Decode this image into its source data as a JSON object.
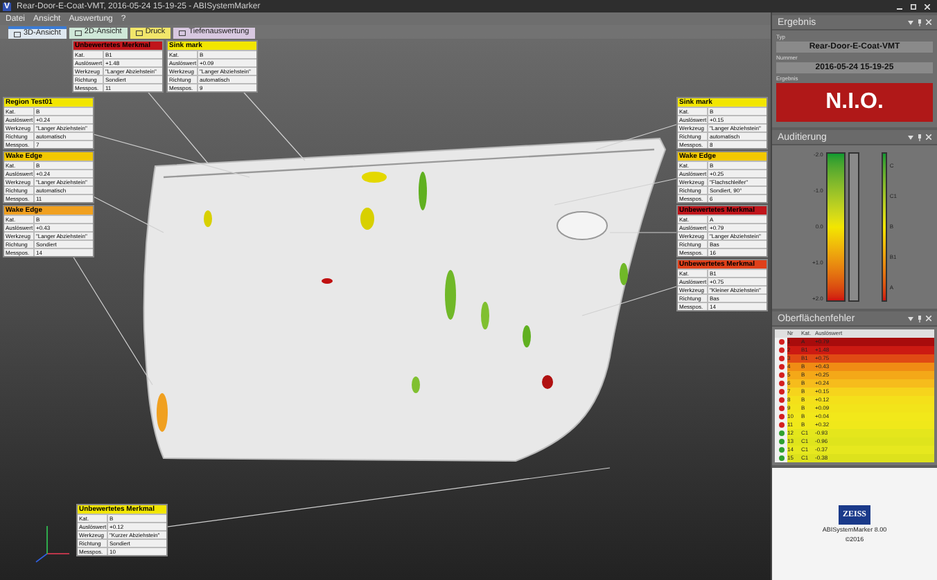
{
  "window": {
    "title": "Rear-Door-E-Coat-VMT, 2016-05-24 15-19-25 - ABISystemMarker",
    "icon": "V"
  },
  "menu": [
    "Datei",
    "Ansicht",
    "Auswertung",
    "?"
  ],
  "tabs": [
    {
      "label": "3D-Ansicht",
      "selected": true,
      "color": "#dfe8f0"
    },
    {
      "label": "2D-Ansicht",
      "selected": false,
      "color": "#cfe8d8"
    },
    {
      "label": "Druck",
      "selected": false,
      "color": "#f2e66a"
    },
    {
      "label": "Tiefenauswertung",
      "selected": false,
      "color": "#d8c8e0"
    }
  ],
  "callouts": [
    {
      "title": "Unbewertetes Merkmal",
      "color": "#c0151b",
      "rows": [
        [
          "Kat.",
          "B1"
        ],
        [
          "Auslöswert",
          "+1.48"
        ],
        [
          "Werkzeug",
          "\"Langer Abziehstein\""
        ],
        [
          "Richtung",
          "Sondiert"
        ],
        [
          "Messpos.",
          "11"
        ]
      ]
    },
    {
      "title": "Sink mark",
      "color": "#f2e600",
      "rows": [
        [
          "Kat.",
          "B"
        ],
        [
          "Auslöswert",
          "+0.09"
        ],
        [
          "Werkzeug",
          "\"Langer Abziehstein\""
        ],
        [
          "Richtung",
          "automatisch"
        ],
        [
          "Messpos.",
          "9"
        ]
      ]
    },
    {
      "title": "Region Test01",
      "color": "#f2e600",
      "rows": [
        [
          "Kat.",
          "B"
        ],
        [
          "Auslöswert",
          "+0.24"
        ],
        [
          "Werkzeug",
          "\"Langer Abziehstein\""
        ],
        [
          "Richtung",
          "automatisch"
        ],
        [
          "Messpos.",
          "7"
        ]
      ]
    },
    {
      "title": "Wake Edge",
      "color": "#f2c800",
      "rows": [
        [
          "Kat.",
          "B"
        ],
        [
          "Auslöswert",
          "+0.24"
        ],
        [
          "Werkzeug",
          "\"Langer Abziehstein\""
        ],
        [
          "Richtung",
          "automatisch"
        ],
        [
          "Messpos.",
          "11"
        ]
      ]
    },
    {
      "title": "Wake Edge",
      "color": "#f0a020",
      "rows": [
        [
          "Kat.",
          "B"
        ],
        [
          "Auslöswert",
          "+0.43"
        ],
        [
          "Werkzeug",
          "\"Langer Abziehstein\""
        ],
        [
          "Richtung",
          "Sondiert"
        ],
        [
          "Messpos.",
          "14"
        ]
      ]
    },
    {
      "title": "Sink mark",
      "color": "#f2e600",
      "rows": [
        [
          "Kat.",
          "B"
        ],
        [
          "Auslöswert",
          "+0.15"
        ],
        [
          "Werkzeug",
          "\"Langer Abziehstein\""
        ],
        [
          "Richtung",
          "automatisch"
        ],
        [
          "Messpos.",
          "8"
        ]
      ]
    },
    {
      "title": "Wake Edge",
      "color": "#f2c800",
      "rows": [
        [
          "Kat.",
          "B"
        ],
        [
          "Auslöswert",
          "+0.25"
        ],
        [
          "Werkzeug",
          "\"Flachschleifer\""
        ],
        [
          "Richtung",
          "Sondiert, 90°"
        ],
        [
          "Messpos.",
          "6"
        ]
      ]
    },
    {
      "title": "Unbewertetes Merkmal",
      "color": "#c0151b",
      "rows": [
        [
          "Kat.",
          "A"
        ],
        [
          "Auslöswert",
          "+0.79"
        ],
        [
          "Werkzeug",
          "\"Langer Abziehstein\""
        ],
        [
          "Richtung",
          "Bas"
        ],
        [
          "Messpos.",
          "16"
        ]
      ]
    },
    {
      "title": "Unbewertetes Merkmal",
      "color": "#e0401a",
      "rows": [
        [
          "Kat.",
          "B1"
        ],
        [
          "Auslöswert",
          "+0.75"
        ],
        [
          "Werkzeug",
          "\"Kleiner Abziehstein\""
        ],
        [
          "Richtung",
          "Bas"
        ],
        [
          "Messpos.",
          "14"
        ]
      ]
    },
    {
      "title": "Unbewertetes Merkmal",
      "color": "#f2e600",
      "rows": [
        [
          "Kat.",
          "B"
        ],
        [
          "Auslöswert",
          "+0.12"
        ],
        [
          "Werkzeug",
          "\"Kurzer Abziehstein\""
        ],
        [
          "Richtung",
          "Sondiert"
        ],
        [
          "Messpos.",
          "10"
        ]
      ]
    }
  ],
  "result": {
    "title": "Ergebnis",
    "type_label": "Typ",
    "type": "Rear-Door-E-Coat-VMT",
    "number_label": "Nummer",
    "number": "2016-05-24 15-19-25",
    "result_label": "Ergebnis",
    "result": "N.I.O."
  },
  "audit": {
    "title": "Auditierung",
    "scale": [
      "-2.0",
      "-1.0",
      "0.0",
      "+1.0",
      "+2.0"
    ],
    "classes": [
      "C",
      "C1",
      "B",
      "B1",
      "A"
    ]
  },
  "defects": {
    "title": "Oberflächenfehler",
    "columns": [
      "Nr",
      "Kat.",
      "Auslöswert"
    ],
    "rows": [
      {
        "cells": [
          "1",
          "A",
          "+0.79"
        ],
        "ok": false,
        "color": "#a80c0c"
      },
      {
        "cells": [
          "2",
          "B1",
          "+1.48"
        ],
        "ok": false,
        "color": "#cc1a12"
      },
      {
        "cells": [
          "3",
          "B1",
          "+0.75"
        ],
        "ok": false,
        "color": "#e04a14"
      },
      {
        "cells": [
          "4",
          "B",
          "+0.43"
        ],
        "ok": false,
        "color": "#f08c14"
      },
      {
        "cells": [
          "5",
          "B",
          "+0.25"
        ],
        "ok": false,
        "color": "#f4a818"
      },
      {
        "cells": [
          "6",
          "B",
          "+0.24"
        ],
        "ok": false,
        "color": "#f6bc1c"
      },
      {
        "cells": [
          "7",
          "B",
          "+0.15"
        ],
        "ok": false,
        "color": "#f6d41c"
      },
      {
        "cells": [
          "8",
          "B",
          "+0.12"
        ],
        "ok": false,
        "color": "#f4e01a"
      },
      {
        "cells": [
          "9",
          "B",
          "+0.09"
        ],
        "ok": false,
        "color": "#f2e41a"
      },
      {
        "cells": [
          "10",
          "B",
          "+0.04"
        ],
        "ok": false,
        "color": "#f2e81a"
      },
      {
        "cells": [
          "11",
          "B",
          "+0.32"
        ],
        "ok": false,
        "color": "#f0e81a"
      },
      {
        "cells": [
          "12",
          "C1",
          "-0.93"
        ],
        "ok": true,
        "color": "#e4e61c"
      },
      {
        "cells": [
          "13",
          "C1",
          "-0.96"
        ],
        "ok": true,
        "color": "#dfe41c"
      },
      {
        "cells": [
          "14",
          "C1",
          "-0.37"
        ],
        "ok": true,
        "color": "#e6e81e"
      },
      {
        "cells": [
          "15",
          "C1",
          "-0.38"
        ],
        "ok": true,
        "color": "#dde21c"
      }
    ]
  },
  "about": {
    "logo": "ZEISS",
    "product": "ABISystemMarker 8.00",
    "copyright": "©2016"
  }
}
